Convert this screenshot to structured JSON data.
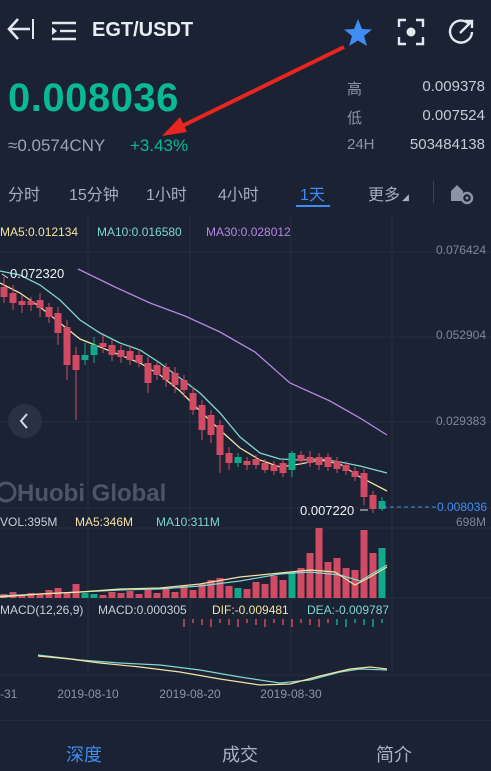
{
  "header": {
    "pair": "EGT/USDT"
  },
  "ticker": {
    "price": "0.008036",
    "cny": "≈0.0574CNY",
    "change": "+3.43%",
    "stats": [
      {
        "label": "高",
        "value": "0.009378"
      },
      {
        "label": "低",
        "value": "0.007524"
      },
      {
        "label": "24H",
        "value": "503484138"
      }
    ]
  },
  "timeframes": {
    "items": [
      "分时",
      "15分钟",
      "1小时",
      "4小时",
      "1天",
      "更多"
    ],
    "active": "1天"
  },
  "chart": {
    "ma_legend": {
      "ma5": "MA5:0.012134",
      "ma10": "MA10:0.016580",
      "ma30": "MA30:0.028012"
    },
    "y_labels": [
      "0.076424",
      "0.052904",
      "0.029383"
    ],
    "high_marker": "0.072320",
    "low_marker": "0.007220",
    "last_price": "0.008036",
    "watermark": "Huobi Global",
    "volume_legend": {
      "vol": "VOL:395M",
      "ma5": "MA5:346M",
      "ma10": "MA10:311M",
      "max": "698M"
    },
    "macd_legend": {
      "params": "MACD(12,26,9)",
      "macd": "MACD:0.000305",
      "dif": "DIF:-0.009481",
      "dea": "DEA:-0.009787"
    },
    "dates": [
      "-31",
      "2019-08-10",
      "2019-08-20",
      "2019-08-30"
    ],
    "colors": {
      "up": "#11a98a",
      "down": "#d04b63",
      "ma5": "#f4e3a3",
      "ma10": "#7ed8ce",
      "ma30": "#b784e6",
      "accent": "#3f8cf2"
    }
  },
  "bottom_tabs": [
    "深度",
    "成交",
    "简介"
  ],
  "bottom_active": "深度"
}
